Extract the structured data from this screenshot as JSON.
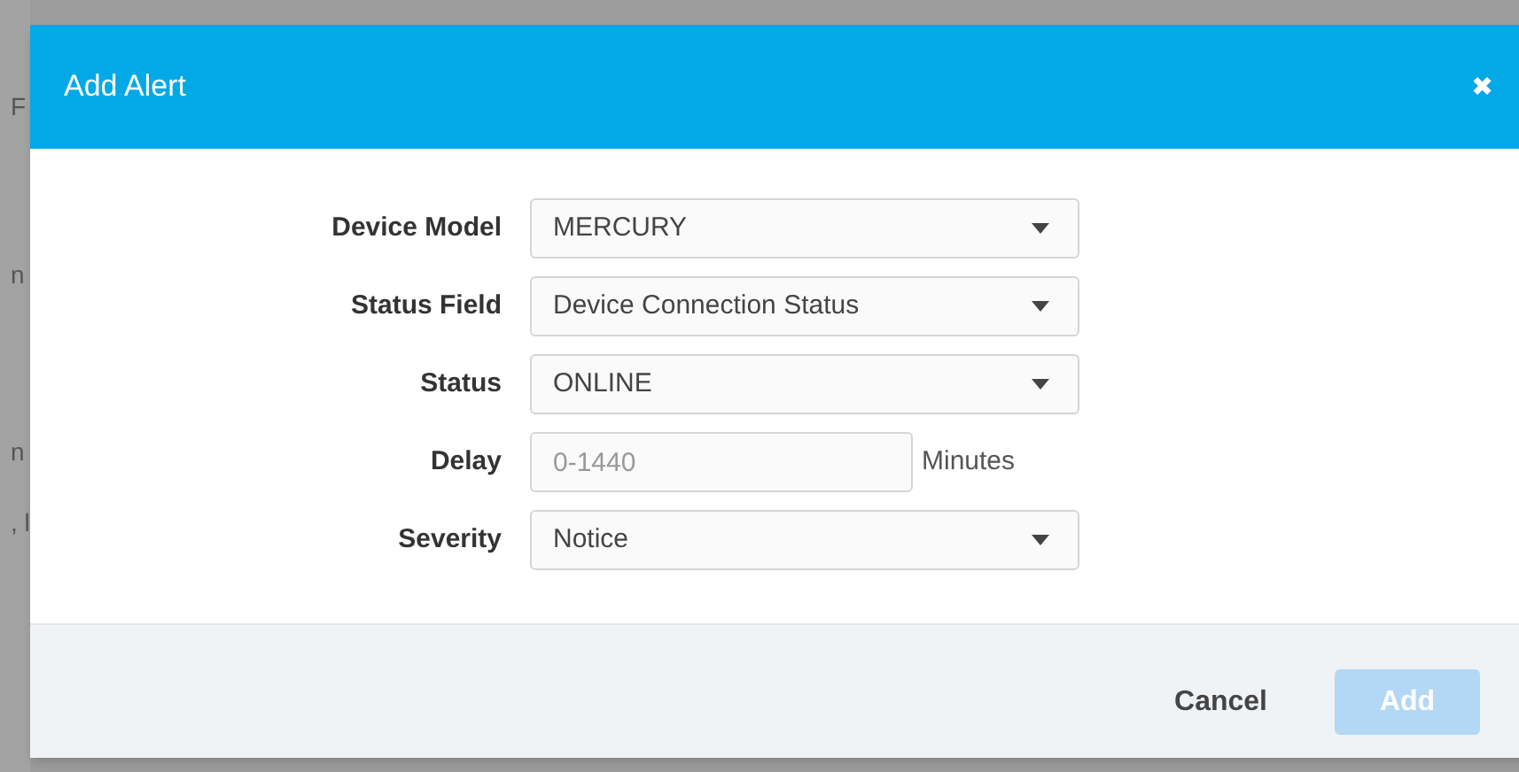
{
  "background": {
    "fragments": [
      "F",
      "n",
      "n",
      ", l"
    ]
  },
  "dialog": {
    "title": "Add Alert",
    "close": "✖"
  },
  "fields": [
    {
      "label": "Device Model",
      "kind": "select",
      "value": "MERCURY"
    },
    {
      "label": "Status Field",
      "kind": "select",
      "value": "Device Connection Status"
    },
    {
      "label": "Status",
      "kind": "select",
      "value": "ONLINE"
    },
    {
      "label": "Delay",
      "kind": "input",
      "placeholder": "0-1440",
      "suffix": "Minutes"
    },
    {
      "label": "Severity",
      "kind": "select",
      "value": "Notice"
    }
  ],
  "buttons": [
    {
      "label": "Cancel",
      "kind": "link",
      "disabled": false
    },
    {
      "label": "Add",
      "kind": "primary",
      "disabled": true
    }
  ]
}
